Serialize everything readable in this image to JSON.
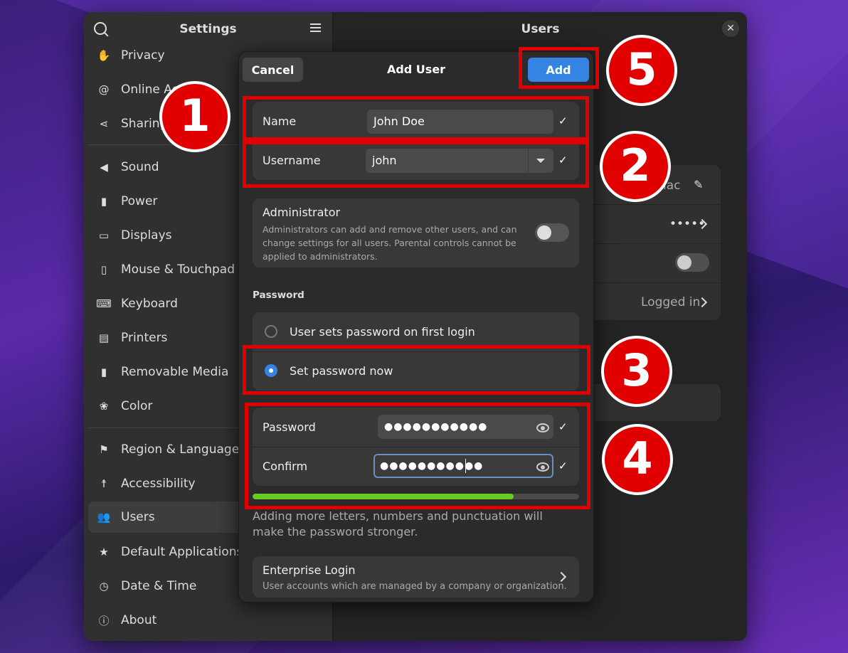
{
  "sidebar": {
    "title": "Settings",
    "items": [
      {
        "label": "Privacy",
        "icon": "hand-icon"
      },
      {
        "label": "Online Acc",
        "icon": "at-icon"
      },
      {
        "label": "Sharing",
        "icon": "share-icon"
      },
      {
        "label": "Sound",
        "icon": "speaker-icon"
      },
      {
        "label": "Power",
        "icon": "battery-icon"
      },
      {
        "label": "Displays",
        "icon": "monitor-icon"
      },
      {
        "label": "Mouse & Touchpad",
        "icon": "mouse-icon"
      },
      {
        "label": "Keyboard",
        "icon": "keyboard-icon"
      },
      {
        "label": "Printers",
        "icon": "printer-icon"
      },
      {
        "label": "Removable Media",
        "icon": "usb-icon"
      },
      {
        "label": "Color",
        "icon": "color-icon"
      },
      {
        "label": "Region & Language",
        "icon": "flag-icon"
      },
      {
        "label": "Accessibility",
        "icon": "accessibility-icon"
      },
      {
        "label": "Users",
        "icon": "users-icon",
        "selected": true
      },
      {
        "label": "Default Applications",
        "icon": "star-icon"
      },
      {
        "label": "Date & Time",
        "icon": "clock-icon"
      },
      {
        "label": "About",
        "icon": "info-icon"
      }
    ]
  },
  "main": {
    "title": "Users",
    "bg_name_fragment": "iac",
    "bg_password_dots": "•••••",
    "bg_logged_in": "Logged in"
  },
  "dialog": {
    "title": "Add User",
    "cancel_label": "Cancel",
    "add_label": "Add",
    "name_label": "Name",
    "name_value": "John Doe",
    "username_label": "Username",
    "username_value": "john",
    "admin_title": "Administrator",
    "admin_desc": "Administrators can add and remove other users, and can change settings for all users. Parental controls cannot be applied to administrators.",
    "admin_enabled": false,
    "password_section": "Password",
    "option_first_login": "User sets password on first login",
    "option_set_now": "Set password now",
    "selected_option": "Set password now",
    "password_label": "Password",
    "password_value": "●●●●●●●●●●●",
    "confirm_label": "Confirm",
    "confirm_value": "●●●●●●●●●●●",
    "strength_fraction": 0.8,
    "strength_hint": "Adding more letters, numbers and punctuation will make the password stronger.",
    "enterprise_title": "Enterprise Login",
    "enterprise_sub": "User accounts which are managed by a company or organization."
  },
  "annotations": {
    "badges": [
      "1",
      "2",
      "3",
      "4",
      "5"
    ],
    "color": "#e00000"
  },
  "colors": {
    "accent": "#3584e4",
    "strength": "#66cc22"
  }
}
